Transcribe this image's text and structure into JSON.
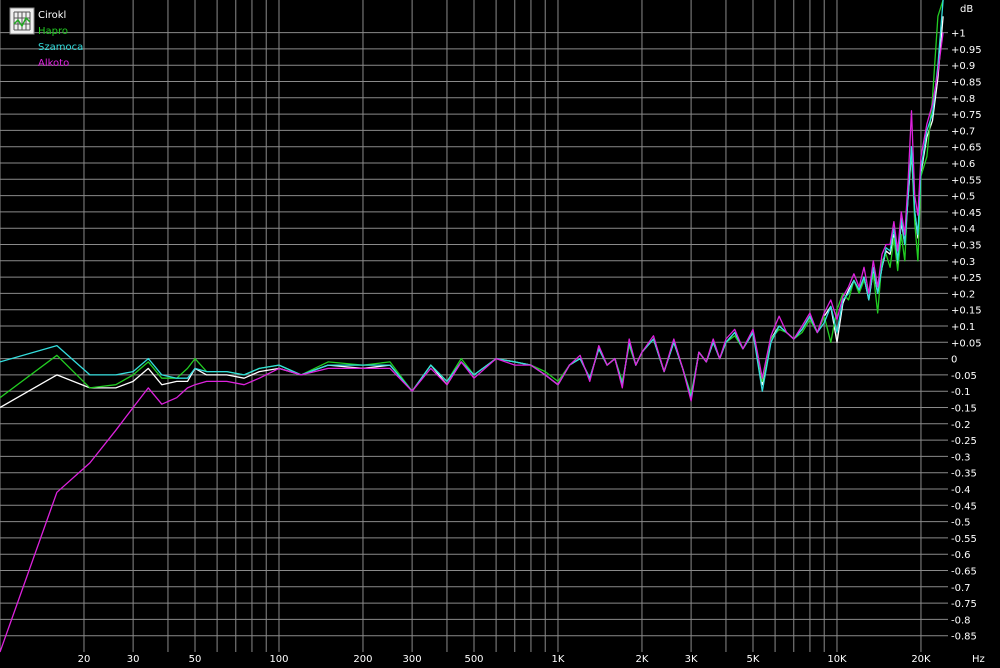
{
  "chart_data": {
    "type": "line",
    "xscale": "log",
    "xlim": [
      10,
      25000
    ],
    "ylim": [
      -0.9,
      1.1
    ],
    "x_unit": "Hz",
    "y_unit": "dB",
    "grid": true,
    "legend_position": "top-left",
    "x_ticks": [
      {
        "v": 20,
        "label": "20"
      },
      {
        "v": 30,
        "label": "30"
      },
      {
        "v": 50,
        "label": "50"
      },
      {
        "v": 100,
        "label": "100"
      },
      {
        "v": 200,
        "label": "200"
      },
      {
        "v": 300,
        "label": "300"
      },
      {
        "v": 500,
        "label": "500"
      },
      {
        "v": 1000,
        "label": "1K"
      },
      {
        "v": 2000,
        "label": "2K"
      },
      {
        "v": 3000,
        "label": "3K"
      },
      {
        "v": 5000,
        "label": "5K"
      },
      {
        "v": 10000,
        "label": "10K"
      },
      {
        "v": 20000,
        "label": "20K"
      }
    ],
    "y_ticks": [
      {
        "v": 1.0,
        "label": "+1"
      },
      {
        "v": 0.95,
        "label": "+0.95"
      },
      {
        "v": 0.9,
        "label": "+0.9"
      },
      {
        "v": 0.85,
        "label": "+0.85"
      },
      {
        "v": 0.8,
        "label": "+0.8"
      },
      {
        "v": 0.75,
        "label": "+0.75"
      },
      {
        "v": 0.7,
        "label": "+0.7"
      },
      {
        "v": 0.65,
        "label": "+0.65"
      },
      {
        "v": 0.6,
        "label": "+0.6"
      },
      {
        "v": 0.55,
        "label": "+0.55"
      },
      {
        "v": 0.5,
        "label": "+0.5"
      },
      {
        "v": 0.45,
        "label": "+0.45"
      },
      {
        "v": 0.4,
        "label": "+0.4"
      },
      {
        "v": 0.35,
        "label": "+0.35"
      },
      {
        "v": 0.3,
        "label": "+0.3"
      },
      {
        "v": 0.25,
        "label": "+0.25"
      },
      {
        "v": 0.2,
        "label": "+0.2"
      },
      {
        "v": 0.15,
        "label": "+0.15"
      },
      {
        "v": 0.1,
        "label": "+0.1"
      },
      {
        "v": 0.05,
        "label": "+0.05"
      },
      {
        "v": 0,
        "label": "0"
      },
      {
        "v": -0.05,
        "label": "-0.05"
      },
      {
        "v": -0.1,
        "label": "-0.1"
      },
      {
        "v": -0.15,
        "label": "-0.15"
      },
      {
        "v": -0.2,
        "label": "-0.2"
      },
      {
        "v": -0.25,
        "label": "-0.25"
      },
      {
        "v": -0.3,
        "label": "-0.3"
      },
      {
        "v": -0.35,
        "label": "-0.35"
      },
      {
        "v": -0.4,
        "label": "-0.4"
      },
      {
        "v": -0.45,
        "label": "-0.45"
      },
      {
        "v": -0.5,
        "label": "-0.5"
      },
      {
        "v": -0.55,
        "label": "-0.55"
      },
      {
        "v": -0.6,
        "label": "-0.6"
      },
      {
        "v": -0.65,
        "label": "-0.65"
      },
      {
        "v": -0.7,
        "label": "-0.7"
      },
      {
        "v": -0.75,
        "label": "-0.75"
      },
      {
        "v": -0.8,
        "label": "-0.8"
      },
      {
        "v": -0.85,
        "label": "-0.85"
      }
    ],
    "series": [
      {
        "name": "Cirokl",
        "color": "#ffffff",
        "x": [
          10,
          16,
          21,
          26,
          30,
          34,
          38,
          43,
          47,
          50,
          55,
          65,
          75,
          85,
          100,
          120,
          150,
          200,
          250,
          300,
          350,
          400,
          450,
          500,
          600,
          700,
          800,
          900,
          1000,
          1100,
          1200,
          1300,
          1400,
          1500,
          1600,
          1700,
          1800,
          1900,
          2000,
          2200,
          2400,
          2600,
          2800,
          3000,
          3200,
          3400,
          3600,
          3800,
          4000,
          4300,
          4600,
          5000,
          5400,
          5800,
          6200,
          6600,
          7000,
          7500,
          8000,
          8500,
          9000,
          9500,
          10000,
          10500,
          11000,
          11500,
          12000,
          12500,
          13000,
          13500,
          14000,
          14500,
          15000,
          15500,
          16000,
          16500,
          17000,
          17500,
          18000,
          18500,
          19000,
          19500,
          20000,
          21000,
          22000,
          23000,
          24000
        ],
        "y": [
          -0.15,
          -0.05,
          -0.09,
          -0.09,
          -0.07,
          -0.03,
          -0.08,
          -0.07,
          -0.07,
          -0.03,
          -0.05,
          -0.05,
          -0.06,
          -0.04,
          -0.03,
          -0.05,
          -0.02,
          -0.03,
          -0.02,
          -0.1,
          -0.02,
          -0.08,
          -0.01,
          -0.05,
          0.0,
          -0.01,
          -0.02,
          -0.05,
          -0.08,
          -0.02,
          0.0,
          -0.06,
          0.03,
          -0.02,
          0.0,
          -0.08,
          0.05,
          -0.02,
          0.02,
          0.06,
          -0.04,
          0.05,
          -0.03,
          -0.12,
          0.02,
          -0.01,
          0.05,
          0.0,
          0.05,
          0.08,
          0.03,
          0.08,
          -0.08,
          0.06,
          0.1,
          0.08,
          0.06,
          0.09,
          0.13,
          0.08,
          0.13,
          0.16,
          0.05,
          0.17,
          0.21,
          0.24,
          0.21,
          0.25,
          0.18,
          0.27,
          0.2,
          0.28,
          0.33,
          0.32,
          0.38,
          0.29,
          0.42,
          0.35,
          0.5,
          0.63,
          0.45,
          0.37,
          0.57,
          0.68,
          0.73,
          0.86,
          1.05
        ]
      },
      {
        "name": "Hapro",
        "color": "#22cc22",
        "x": [
          10,
          16,
          21,
          26,
          30,
          34,
          38,
          43,
          47,
          50,
          55,
          65,
          75,
          85,
          100,
          120,
          150,
          200,
          250,
          300,
          350,
          400,
          450,
          500,
          600,
          700,
          800,
          900,
          1000,
          1100,
          1200,
          1300,
          1400,
          1500,
          1600,
          1700,
          1800,
          1900,
          2000,
          2200,
          2400,
          2600,
          2800,
          3000,
          3200,
          3400,
          3600,
          3800,
          4000,
          4300,
          4600,
          5000,
          5400,
          5800,
          6200,
          6600,
          7000,
          7500,
          8000,
          8500,
          9000,
          9500,
          10000,
          10500,
          11000,
          11500,
          12000,
          12500,
          13000,
          13500,
          14000,
          14500,
          15000,
          15500,
          16000,
          16500,
          17000,
          17500,
          18000,
          18500,
          19000,
          19500,
          20000,
          21000,
          22000,
          23000,
          24000
        ],
        "y": [
          -0.12,
          0.01,
          -0.09,
          -0.08,
          -0.05,
          -0.01,
          -0.06,
          -0.06,
          -0.03,
          0.0,
          -0.04,
          -0.04,
          -0.05,
          -0.03,
          -0.02,
          -0.05,
          -0.01,
          -0.02,
          -0.01,
          -0.1,
          -0.02,
          -0.07,
          0.0,
          -0.05,
          0.0,
          -0.01,
          -0.02,
          -0.04,
          -0.07,
          -0.02,
          0.0,
          -0.06,
          0.03,
          -0.02,
          0.0,
          -0.07,
          0.04,
          -0.02,
          0.02,
          0.06,
          -0.04,
          0.05,
          -0.03,
          -0.11,
          0.02,
          -0.01,
          0.05,
          0.0,
          0.05,
          0.07,
          0.03,
          0.08,
          -0.07,
          0.06,
          0.09,
          0.08,
          0.06,
          0.08,
          0.12,
          0.08,
          0.13,
          0.05,
          0.15,
          0.2,
          0.18,
          0.24,
          0.2,
          0.24,
          0.2,
          0.26,
          0.14,
          0.3,
          0.32,
          0.28,
          0.37,
          0.27,
          0.38,
          0.3,
          0.52,
          0.64,
          0.42,
          0.3,
          0.56,
          0.62,
          0.8,
          1.05,
          1.1
        ]
      },
      {
        "name": "Szamoca",
        "color": "#33dddd",
        "x": [
          10,
          16,
          21,
          26,
          30,
          34,
          38,
          43,
          47,
          50,
          55,
          65,
          75,
          85,
          100,
          120,
          150,
          200,
          250,
          300,
          350,
          400,
          450,
          500,
          600,
          700,
          800,
          900,
          1000,
          1100,
          1200,
          1300,
          1400,
          1500,
          1600,
          1700,
          1800,
          1900,
          2000,
          2200,
          2400,
          2600,
          2800,
          3000,
          3200,
          3400,
          3600,
          3800,
          4000,
          4300,
          4600,
          5000,
          5400,
          5800,
          6200,
          6600,
          7000,
          7500,
          8000,
          8500,
          9000,
          9500,
          10000,
          10500,
          11000,
          11500,
          12000,
          12500,
          13000,
          13500,
          14000,
          14500,
          15000,
          15500,
          16000,
          16500,
          17000,
          17500,
          18000,
          18500,
          19000,
          19500,
          20000,
          21000,
          22000,
          23000,
          24000
        ],
        "y": [
          -0.01,
          0.04,
          -0.05,
          -0.05,
          -0.04,
          0.0,
          -0.05,
          -0.06,
          -0.06,
          -0.03,
          -0.04,
          -0.04,
          -0.05,
          -0.03,
          -0.02,
          -0.05,
          -0.02,
          -0.02,
          -0.02,
          -0.1,
          -0.02,
          -0.07,
          -0.01,
          -0.05,
          0.0,
          -0.01,
          -0.02,
          -0.05,
          -0.08,
          -0.02,
          0.0,
          -0.06,
          0.03,
          -0.02,
          0.0,
          -0.08,
          0.05,
          -0.02,
          0.02,
          0.06,
          -0.04,
          0.05,
          -0.03,
          -0.12,
          0.02,
          -0.01,
          0.05,
          0.0,
          0.05,
          0.08,
          0.03,
          0.08,
          -0.1,
          0.05,
          0.1,
          0.08,
          0.06,
          0.09,
          0.13,
          0.08,
          0.11,
          0.16,
          0.08,
          0.18,
          0.2,
          0.24,
          0.21,
          0.25,
          0.18,
          0.28,
          0.2,
          0.28,
          0.34,
          0.33,
          0.4,
          0.3,
          0.43,
          0.35,
          0.5,
          0.65,
          0.45,
          0.38,
          0.58,
          0.7,
          0.75,
          0.9,
          1.1
        ]
      },
      {
        "name": "Alkoto",
        "color": "#dd22dd",
        "x": [
          10,
          16,
          21,
          26,
          30,
          34,
          38,
          43,
          47,
          50,
          55,
          65,
          75,
          85,
          100,
          120,
          150,
          200,
          250,
          300,
          350,
          400,
          450,
          500,
          600,
          700,
          800,
          900,
          1000,
          1100,
          1200,
          1300,
          1400,
          1500,
          1600,
          1700,
          1800,
          1900,
          2000,
          2200,
          2400,
          2600,
          2800,
          3000,
          3200,
          3400,
          3600,
          3800,
          4000,
          4300,
          4600,
          5000,
          5400,
          5800,
          6200,
          6600,
          7000,
          7500,
          8000,
          8500,
          9000,
          9500,
          10000,
          10500,
          11000,
          11500,
          12000,
          12500,
          13000,
          13500,
          14000,
          14500,
          15000,
          15500,
          16000,
          16500,
          17000,
          17500,
          18000,
          18500,
          19000,
          19500,
          20000,
          21000,
          22000,
          23000,
          24000
        ],
        "y": [
          -0.9,
          -0.41,
          -0.32,
          -0.22,
          -0.15,
          -0.09,
          -0.14,
          -0.12,
          -0.09,
          -0.08,
          -0.07,
          -0.07,
          -0.08,
          -0.06,
          -0.03,
          -0.05,
          -0.03,
          -0.03,
          -0.03,
          -0.1,
          -0.03,
          -0.08,
          -0.01,
          -0.06,
          0.0,
          -0.02,
          -0.02,
          -0.05,
          -0.08,
          -0.02,
          0.01,
          -0.07,
          0.04,
          -0.02,
          0.0,
          -0.09,
          0.06,
          -0.02,
          0.02,
          0.07,
          -0.04,
          0.06,
          -0.03,
          -0.13,
          0.02,
          -0.01,
          0.06,
          0.0,
          0.06,
          0.09,
          0.03,
          0.09,
          -0.06,
          0.07,
          0.13,
          0.08,
          0.06,
          0.1,
          0.14,
          0.08,
          0.14,
          0.18,
          0.12,
          0.19,
          0.22,
          0.26,
          0.22,
          0.28,
          0.2,
          0.3,
          0.22,
          0.32,
          0.35,
          0.35,
          0.42,
          0.33,
          0.45,
          0.38,
          0.55,
          0.76,
          0.5,
          0.44,
          0.62,
          0.72,
          0.78,
          0.88,
          1.0
        ]
      }
    ]
  }
}
